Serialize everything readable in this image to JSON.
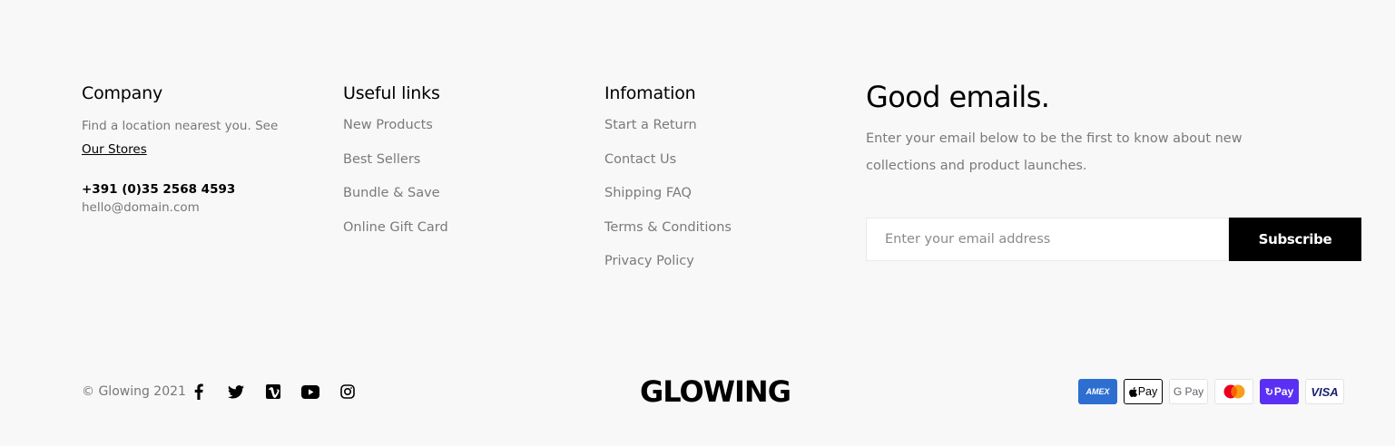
{
  "company": {
    "heading": "Company",
    "text_before_link": "Find a location nearest you. See ",
    "stores_link": "Our Stores",
    "phone": "+391 (0)35 2568 4593",
    "email": "hello@domain.com"
  },
  "useful_links": {
    "heading": "Useful links",
    "items": [
      "New Products",
      "Best Sellers",
      "Bundle & Save",
      "Online Gift Card"
    ]
  },
  "information": {
    "heading": "Infomation",
    "items": [
      "Start a Return",
      "Contact Us",
      "Shipping FAQ",
      "Terms & Conditions",
      "Privacy Policy"
    ]
  },
  "newsletter": {
    "title": "Good emails.",
    "description": "Enter your email below to be the first to know about new collections and product launches.",
    "email_placeholder": "Enter your email address",
    "email_value": "",
    "subscribe_label": "Subscribe"
  },
  "bottom": {
    "copyright": "© Glowing 2021",
    "socials": [
      "facebook-icon",
      "twitter-icon",
      "vimeo-icon",
      "youtube-icon",
      "instagram-icon"
    ],
    "logo": "GLOWING",
    "payments": {
      "amex": "AMEX",
      "apple_pay": "Pay",
      "google_pay": "G Pay",
      "shop_pay": "Pay",
      "visa": "VISA"
    }
  },
  "colors": {
    "background": "#f8f8f8",
    "muted_text": "#777777",
    "button": "#000000",
    "amex": "#2c6fd1",
    "shop_pay": "#5a31f4",
    "mastercard_red": "#eb001b",
    "mastercard_orange": "#f79e1b"
  }
}
